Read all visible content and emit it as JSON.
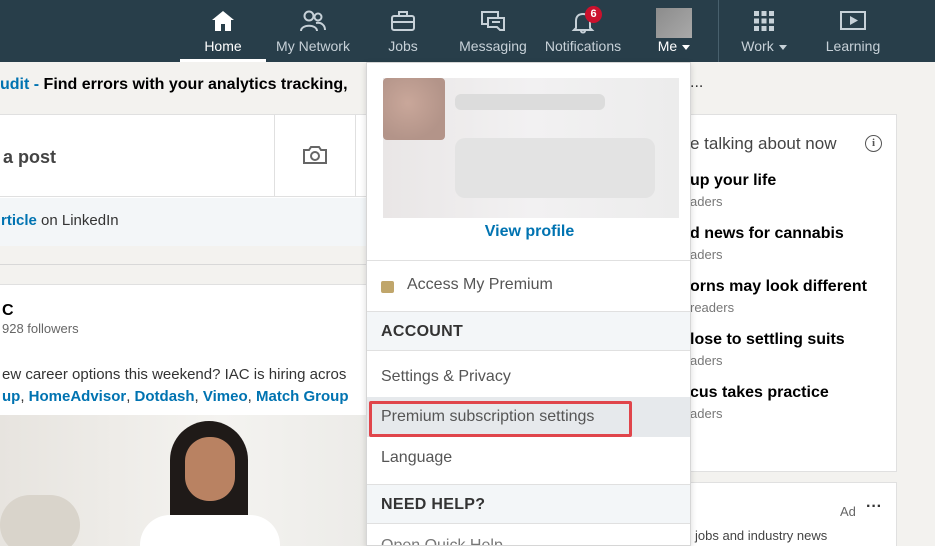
{
  "nav": {
    "items": [
      {
        "label": "Home",
        "icon": "home-icon"
      },
      {
        "label": "My Network",
        "icon": "network-icon"
      },
      {
        "label": "Jobs",
        "icon": "briefcase-icon"
      },
      {
        "label": "Messaging",
        "icon": "messaging-icon"
      },
      {
        "label": "Notifications",
        "icon": "bell-icon",
        "badge": "6"
      },
      {
        "label": "Me",
        "icon": "avatar"
      },
      {
        "label": "Work",
        "icon": "grid-icon"
      },
      {
        "label": "Learning",
        "icon": "play-icon"
      }
    ],
    "active": "Home"
  },
  "banner": {
    "link_text": "udit -",
    "text": " Find errors with your analytics tracking,",
    "overflow": "..."
  },
  "post_box": {
    "prompt": "a post",
    "article_link": "rticle",
    "article_suffix": " on LinkedIn"
  },
  "feed_post": {
    "company": "C",
    "followers": "928 followers",
    "body": "ew career options this weekend? IAC is hiring acros",
    "links": [
      "up",
      "HomeAdvisor",
      "Dotdash",
      "Vimeo",
      "Match Group"
    ]
  },
  "right_rail": {
    "title": "e talking about now",
    "news": [
      {
        "headline": "up your life",
        "sub": "aders"
      },
      {
        "headline": "d news for cannabis",
        "sub": "aders"
      },
      {
        "headline": "orns may look different",
        "sub": "readers"
      },
      {
        "headline": "lose to settling suits",
        "sub": "aders"
      },
      {
        "headline": "cus takes practice",
        "sub": "aders"
      }
    ],
    "ad_label": "Ad",
    "ad_text": "jobs and industry news"
  },
  "dropdown": {
    "view_profile": "View profile",
    "access_premium": "Access My Premium",
    "account_header": "ACCOUNT",
    "settings_privacy": "Settings & Privacy",
    "premium_settings": "Premium subscription settings",
    "language": "Language",
    "help_header": "NEED HELP?",
    "partial_item": "Open Quick Help"
  },
  "colors": {
    "nav_bg": "#283e4a",
    "link": "#0073b1",
    "highlight_border": "#e0454b",
    "badge": "#cb112d"
  }
}
